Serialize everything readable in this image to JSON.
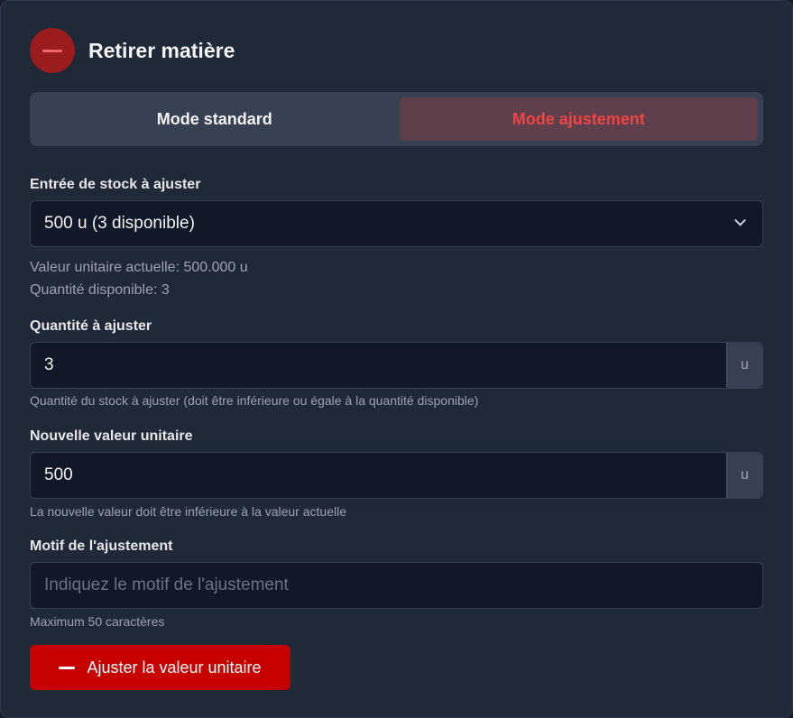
{
  "header": {
    "title": "Retirer matière",
    "icon": "minus-icon"
  },
  "modes": {
    "standard_label": "Mode standard",
    "adjust_label": "Mode ajustement",
    "active": "Mode ajustement"
  },
  "stock_entry": {
    "label": "Entrée de stock à ajuster",
    "selected": "500 u (3 disponible)",
    "current_value_text": "Valeur unitaire actuelle: 500.000 u",
    "available_text": "Quantité disponible: 3"
  },
  "quantity": {
    "label": "Quantité à ajuster",
    "value": "3",
    "unit": "u",
    "help": "Quantité du stock à ajuster (doit être inférieure ou égale à la quantité disponible)"
  },
  "new_value": {
    "label": "Nouvelle valeur unitaire",
    "value": "500",
    "unit": "u",
    "help": "La nouvelle valeur doit être inférieure à la valeur actuelle"
  },
  "reason": {
    "label": "Motif de l'ajustement",
    "placeholder": "Indiquez le motif de l'ajustement",
    "help": "Maximum 50 caractères"
  },
  "submit": {
    "label": "Ajuster la valeur unitaire",
    "icon": "minus-icon"
  },
  "colors": {
    "accent": "#c70000",
    "active_mode_text": "#ef4444",
    "panel_bg": "#1f2937",
    "input_bg": "#111827"
  }
}
